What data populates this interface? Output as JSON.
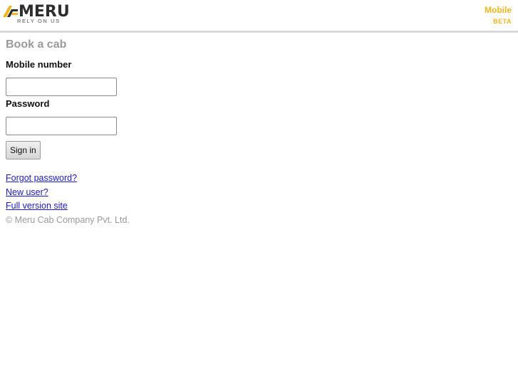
{
  "header": {
    "logo_word": "MERU",
    "logo_tagline": "RELY ON US",
    "mobile_label": "Mobile",
    "beta_label": "BETA",
    "accent_color": "#f2b51d"
  },
  "form": {
    "title": "Book a cab",
    "mobile_label": "Mobile number",
    "mobile_value": "",
    "password_label": "Password",
    "password_value": "",
    "signin_label": "Sign in"
  },
  "links": {
    "forgot_password": "Forgot password?",
    "new_user": "New user?",
    "full_version": "Full version site"
  },
  "footer": {
    "copyright": "© Meru Cab Company Pvt. Ltd."
  }
}
